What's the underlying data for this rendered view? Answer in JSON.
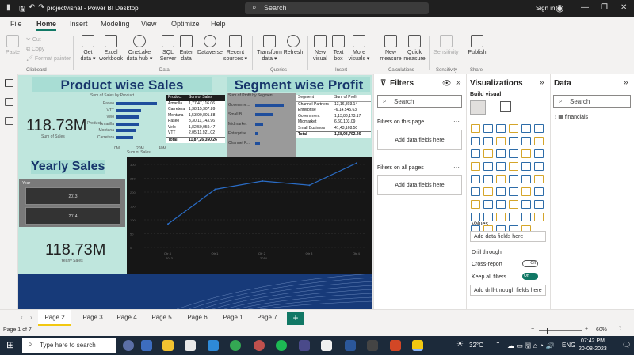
{
  "titlebar": {
    "title": "projectvishal - Power BI Desktop",
    "search_placeholder": "Search",
    "signin": "Sign in"
  },
  "menu": [
    "File",
    "Home",
    "Insert",
    "Modeling",
    "View",
    "Optimize",
    "Help"
  ],
  "ribbon": {
    "buttons": [
      "Paste",
      "Get data ▾",
      "Excel workbook",
      "OneLake data hub ▾",
      "SQL Server",
      "Enter data",
      "Dataverse",
      "Recent sources ▾",
      "Transform data ▾",
      "Refresh",
      "New visual",
      "Text box",
      "More visuals ▾",
      "New measure",
      "Quick measure",
      "Sensitivity",
      "Publish"
    ],
    "clipboard_items": [
      "Cut",
      "Copy",
      "Format painter"
    ],
    "groups": [
      "Clipboard",
      "Data",
      "Queries",
      "Insert",
      "Calculations",
      "Sensitivity",
      "Share"
    ]
  },
  "report": {
    "title1": "Product wise Sales",
    "title2": "Segment wise Profit",
    "title3": "Yearly Sales",
    "product_chart_title": "Sum of Sales by Product",
    "product_bars": [
      {
        "name": "Paseo",
        "v": 1.0
      },
      {
        "name": "VTT",
        "v": 0.62
      },
      {
        "name": "Velo",
        "v": 0.58
      },
      {
        "name": "Amarilla",
        "v": 0.55
      },
      {
        "name": "Montana",
        "v": 0.48
      },
      {
        "name": "Carretera",
        "v": 0.42
      }
    ],
    "product_axis": [
      "0M",
      "20M",
      "40M"
    ],
    "product_xlabel": "Sum of Sales",
    "product_ylabel": "Product",
    "kpi_value": "118.73M",
    "kpi_label": "Sum of Sales",
    "product_table": {
      "headers": [
        "Product",
        "Sum of Sales"
      ],
      "rows": [
        [
          "Amarilla",
          "1,77,47,116.06"
        ],
        [
          "Carretera",
          "1,38,15,307.89"
        ],
        [
          "Montana",
          "1,53,90,801.88"
        ],
        [
          "Paseo",
          "3,30,11,143.96"
        ],
        [
          "Velo",
          "1,82,50,059.47"
        ],
        [
          "VTT",
          "2,05,11,921.02"
        ]
      ],
      "total": [
        "Total",
        "11,87,26,350.26"
      ]
    },
    "segment_chart_title": "Sum of Profit by Segment",
    "segment_bars": [
      {
        "name": "Governme...",
        "v": 1.0
      },
      {
        "name": "Small B...",
        "v": 0.65
      },
      {
        "name": "Midmarket",
        "v": 0.28
      },
      {
        "name": "Enterprise",
        "v": 0.12
      },
      {
        "name": "Channel P...",
        "v": 0.18
      }
    ],
    "segment_table": {
      "headers": [
        "Segment",
        "Sum of Profit"
      ],
      "rows": [
        [
          "Channel Partners",
          "13,16,803.14"
        ],
        [
          "Enterprise",
          "-6,14,545.63"
        ],
        [
          "Government",
          "1,13,88,173.17"
        ],
        [
          "Midmarket",
          "6,60,103.09"
        ],
        [
          "Small Business",
          "41,43,168.50"
        ]
      ],
      "total": [
        "Total",
        "1,68,93,702.26"
      ]
    },
    "year_slicer_label": "Year",
    "years": [
      "2013",
      "2014"
    ],
    "kpi2_value": "118.73M",
    "kpi2_label": "Yearly Sales",
    "line_x": [
      "Qtr 4",
      "Qtr 1",
      "Qtr 2",
      "Qtr 3",
      "Qtr 4"
    ],
    "line_year_labels": [
      "2013",
      "2014"
    ],
    "line_y": [
      "0",
      "50",
      "100",
      "150",
      "200",
      "250",
      "300"
    ]
  },
  "chart_data": {
    "type": "line",
    "x": [
      "2013 Qtr 4",
      "2014 Qtr 1",
      "2014 Qtr 2",
      "2014 Qtr 3",
      "2014 Qtr 4"
    ],
    "values": [
      85,
      210,
      240,
      225,
      305
    ],
    "ylim": [
      0,
      300
    ]
  },
  "filters": {
    "title": "Filters",
    "search": "Search",
    "on_page": "Filters on this page",
    "on_all": "Filters on all pages",
    "add": "Add data fields here"
  },
  "viz": {
    "title": "Visualizations",
    "build": "Build visual",
    "values": "Values",
    "add": "Add data fields here",
    "drill": "Drill through",
    "cross": "Cross-report",
    "cross_state": "Off",
    "keep": "Keep all filters",
    "keep_state": "On",
    "add_drill": "Add drill-through fields here"
  },
  "data_pane": {
    "title": "Data",
    "search": "Search",
    "table": "financials"
  },
  "pages": [
    "Page 2",
    "Page 3",
    "Page 4",
    "Page 5",
    "Page 6",
    "Page 1",
    "Page 7"
  ],
  "status": {
    "page": "Page 1 of 7",
    "zoom": "60%"
  },
  "taskbar": {
    "search": "Type here to search",
    "temp": "32°C",
    "lang": "ENG",
    "time": "07:42 PM",
    "date": "20-08-2023"
  },
  "colors": {
    "accent": "#117865",
    "teal": "#a8ddd4",
    "navy": "#173a79",
    "dark": "#1e1e1e"
  }
}
